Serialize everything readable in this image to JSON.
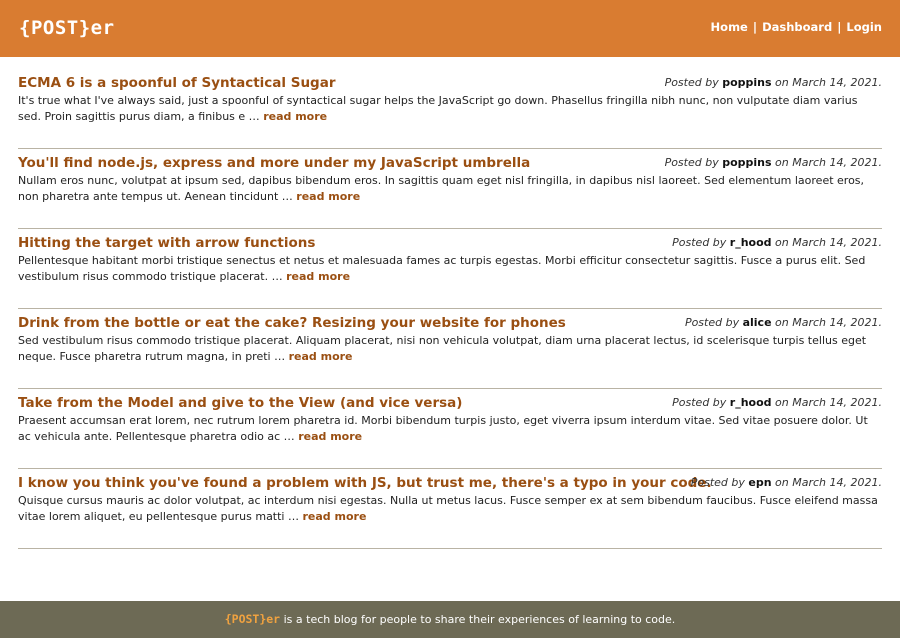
{
  "header": {
    "logo": "{POST}er",
    "nav": {
      "home": "Home",
      "dashboard": "Dashboard",
      "login": "Login",
      "separator": "|"
    }
  },
  "posts": [
    {
      "title": "ECMA 6 is a spoonful of Syntactical Sugar",
      "posted_by_label": "Posted by",
      "author": "poppins",
      "date_text": "on March 14, 2021.",
      "excerpt": "It's true what I've always said, just a spoonful of syntactical sugar helps the JavaScript go down. Phasellus fringilla nibh nunc, non vulputate diam varius sed. Proin sagittis purus diam, a finibus e …",
      "read_more": "read more"
    },
    {
      "title": "You'll find node.js, express and more under my JavaScript umbrella",
      "posted_by_label": "Posted by",
      "author": "poppins",
      "date_text": "on March 14, 2021.",
      "excerpt": "Nullam eros nunc, volutpat at ipsum sed, dapibus bibendum eros. In sagittis quam eget nisl fringilla, in dapibus nisl laoreet. Sed elementum laoreet eros, non pharetra ante tempus ut. Aenean tincidunt …",
      "read_more": "read more"
    },
    {
      "title": "Hitting the target with arrow functions",
      "posted_by_label": "Posted by",
      "author": "r_hood",
      "date_text": "on March 14, 2021.",
      "excerpt": "Pellentesque habitant morbi tristique senectus et netus et malesuada fames ac turpis egestas. Morbi efficitur consectetur sagittis. Fusce a purus elit. Sed vestibulum risus commodo tristique placerat. …",
      "read_more": "read more"
    },
    {
      "title": "Drink from the bottle or eat the cake? Resizing your website for phones",
      "posted_by_label": "Posted by",
      "author": "alice",
      "date_text": "on March 14, 2021.",
      "excerpt": "Sed vestibulum risus commodo tristique placerat. Aliquam placerat, nisi non vehicula volutpat, diam urna placerat lectus, id scelerisque turpis tellus eget neque. Fusce pharetra rutrum magna, in preti …",
      "read_more": "read more"
    },
    {
      "title": "Take from the Model and give to the View (and vice versa)",
      "posted_by_label": "Posted by",
      "author": "r_hood",
      "date_text": "on March 14, 2021.",
      "excerpt": "Praesent accumsan erat lorem, nec rutrum lorem pharetra id. Morbi bibendum turpis justo, eget viverra ipsum interdum vitae. Sed vitae posuere dolor. Ut ac vehicula ante. Pellentesque pharetra odio ac …",
      "read_more": "read more"
    },
    {
      "title": "I know you think you've found a problem with JS, but trust me, there's a typo in your code.",
      "posted_by_label": "Posted by",
      "author": "epn",
      "date_text": "on March 14, 2021.",
      "excerpt": "Quisque cursus mauris ac dolor volutpat, ac interdum nisi egestas. Nulla ut metus lacus. Fusce semper ex at sem bibendum faucibus. Fusce eleifend massa vitae lorem aliquet, eu pellentesque purus matti …",
      "read_more": "read more"
    }
  ],
  "footer": {
    "logo": "{POST}er",
    "text": "is a tech blog for people to share their experiences of learning to code."
  },
  "colors": {
    "header_bg": "#d97c31",
    "accent": "#9a4f12",
    "footer_bg": "#6d6a55",
    "footer_logo": "#f0a240",
    "divider": "#b9b3a4"
  }
}
